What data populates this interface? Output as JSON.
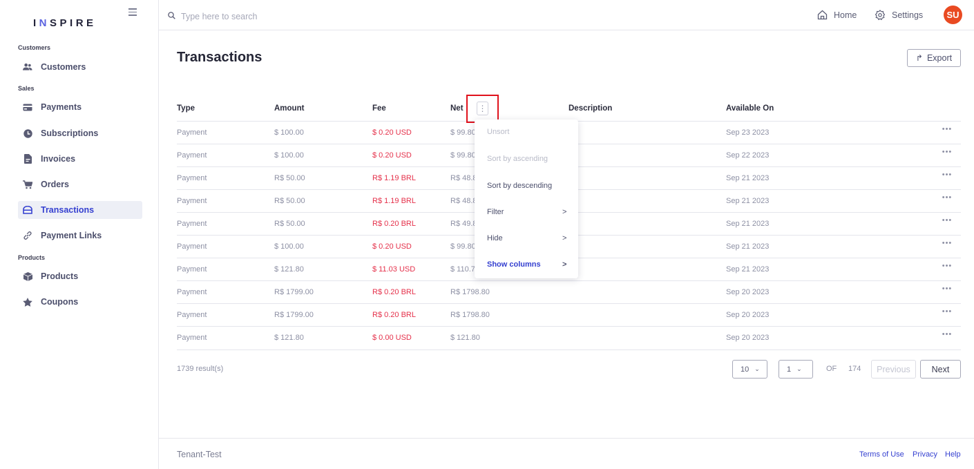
{
  "app": {
    "logo_text_1": "I",
    "logo_text_accent": "N",
    "logo_text_2": "SPIRE"
  },
  "sidebar": {
    "sections": [
      {
        "label": "Customers"
      },
      {
        "label": "Sales"
      },
      {
        "label": "Products"
      }
    ],
    "items": [
      {
        "label": "Customers",
        "icon": "users-icon"
      },
      {
        "label": "Payments",
        "icon": "credit-card-icon"
      },
      {
        "label": "Subscriptions",
        "icon": "clock-icon"
      },
      {
        "label": "Invoices",
        "icon": "document-icon"
      },
      {
        "label": "Orders",
        "icon": "cart-icon"
      },
      {
        "label": "Transactions",
        "icon": "wallet-icon",
        "active": true
      },
      {
        "label": "Payment Links",
        "icon": "link-icon"
      },
      {
        "label": "Products",
        "icon": "box-icon"
      },
      {
        "label": "Coupons",
        "icon": "star-icon"
      }
    ]
  },
  "topbar": {
    "search_placeholder": "Type here to search",
    "home_label": "Home",
    "settings_label": "Settings",
    "avatar_initials": "SU"
  },
  "page": {
    "title": "Transactions",
    "export_label": "Export"
  },
  "table": {
    "columns": [
      "Type",
      "Amount",
      "Fee",
      "Net",
      "Description",
      "Available On"
    ],
    "more_glyph": "•••",
    "rows": [
      {
        "type": "Payment",
        "amount": "$ 100.00",
        "fee": "$ 0.20 USD",
        "net": "$ 99.80",
        "available": "Sep 23 2023"
      },
      {
        "type": "Payment",
        "amount": "$ 100.00",
        "fee": "$ 0.20 USD",
        "net": "$ 99.80",
        "available": "Sep 22 2023"
      },
      {
        "type": "Payment",
        "amount": "R$ 50.00",
        "fee": "R$ 1.19 BRL",
        "net": "R$ 48.8",
        "available": "Sep 21 2023"
      },
      {
        "type": "Payment",
        "amount": "R$ 50.00",
        "fee": "R$ 1.19 BRL",
        "net": "R$ 48.8",
        "available": "Sep 21 2023"
      },
      {
        "type": "Payment",
        "amount": "R$ 50.00",
        "fee": "R$ 0.20 BRL",
        "net": "R$ 49.8",
        "available": "Sep 21 2023"
      },
      {
        "type": "Payment",
        "amount": "$ 100.00",
        "fee": "$ 0.20 USD",
        "net": "$ 99.80",
        "available": "Sep 21 2023"
      },
      {
        "type": "Payment",
        "amount": "$ 121.80",
        "fee": "$ 11.03 USD",
        "net": "$ 110.7",
        "available": "Sep 21 2023"
      },
      {
        "type": "Payment",
        "amount": "R$ 1799.00",
        "fee": "R$ 0.20 BRL",
        "net": "R$ 1798.80",
        "available": "Sep 20 2023"
      },
      {
        "type": "Payment",
        "amount": "R$ 1799.00",
        "fee": "R$ 0.20 BRL",
        "net": "R$ 1798.80",
        "available": "Sep 20 2023"
      },
      {
        "type": "Payment",
        "amount": "$ 121.80",
        "fee": "$ 0.00 USD",
        "net": "$ 121.80",
        "available": "Sep 20 2023"
      }
    ]
  },
  "column_menu": {
    "button_glyph": "⋮",
    "items": [
      {
        "label": "Unsort",
        "disabled": true
      },
      {
        "label": "Sort by ascending",
        "disabled": true
      },
      {
        "label": "Sort by descending"
      },
      {
        "label": "Filter",
        "submenu": true
      },
      {
        "label": "Hide",
        "submenu": true
      },
      {
        "label": "Show columns",
        "submenu": true,
        "strong": true
      }
    ],
    "chevron_glyph": ">"
  },
  "pagination": {
    "results": "1739 result(s)",
    "page_size": "10",
    "current_page": "1",
    "of_label": "OF",
    "total_pages": "174",
    "previous_label": "Previous",
    "next_label": "Next"
  },
  "footer": {
    "tenant": "Tenant-Test",
    "links": [
      "Terms of Use",
      "Privacy",
      "Help"
    ]
  },
  "colors": {
    "accent": "#3540d0",
    "fee_red": "#e5304a",
    "avatar": "#e94a22",
    "highlight": "#e0121c"
  }
}
